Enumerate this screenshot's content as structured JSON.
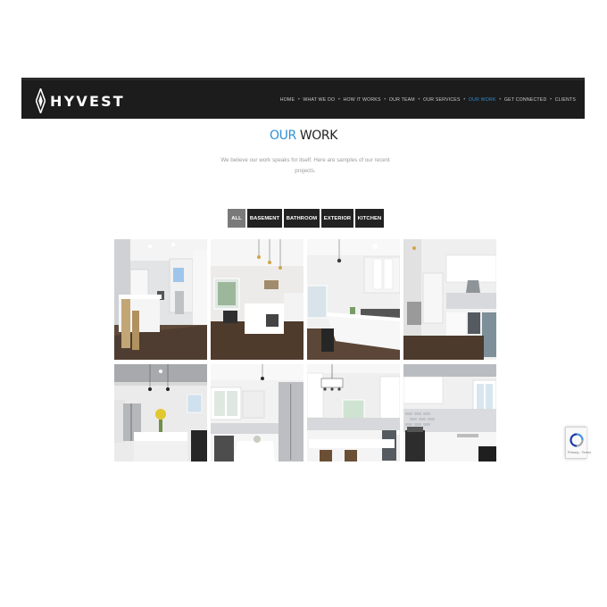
{
  "brand": {
    "name": "HYVEST"
  },
  "nav": {
    "items": [
      {
        "label": "HOME",
        "active": false
      },
      {
        "label": "WHAT WE DO",
        "active": false
      },
      {
        "label": "HOW IT WORKS",
        "active": false
      },
      {
        "label": "OUR TEAM",
        "active": false
      },
      {
        "label": "OUR SERVICES",
        "active": false
      },
      {
        "label": "OUR WORK",
        "active": true
      },
      {
        "label": "GET CONNECTED",
        "active": false
      },
      {
        "label": "CLIENTS",
        "active": false
      }
    ],
    "separator": "•"
  },
  "page": {
    "title_accent": "OUR",
    "title_main": "WORK",
    "intro_line1": "We believe our work speaks for itself. Here are samples of our recent",
    "intro_line2": "projects."
  },
  "filters": [
    {
      "label": "ALL",
      "active": true
    },
    {
      "label": "BASEMENT",
      "active": false
    },
    {
      "label": "BATHROOM",
      "active": false
    },
    {
      "label": "EXTERIOR",
      "active": false
    },
    {
      "label": "KITCHEN",
      "active": false
    }
  ],
  "gallery": {
    "photos": [
      {
        "subject": "kitchen island with bar stools"
      },
      {
        "subject": "kitchen with pendant lights and dining area"
      },
      {
        "subject": "kitchen island with white counter"
      },
      {
        "subject": "white cabinet kitchen with range hood"
      },
      {
        "subject": "kitchen with stainless fridge and flowers"
      },
      {
        "subject": "kitchen with sink and window"
      },
      {
        "subject": "kitchen with chandelier and island"
      },
      {
        "subject": "kitchen with gas range and subway tile"
      }
    ]
  },
  "recaptcha": {
    "text": "Privacy - Terms"
  },
  "colors": {
    "accent": "#2f8fd6",
    "navbar": "#1c1c1c",
    "filter_active": "#7a7a7a",
    "filter": "#222222"
  }
}
